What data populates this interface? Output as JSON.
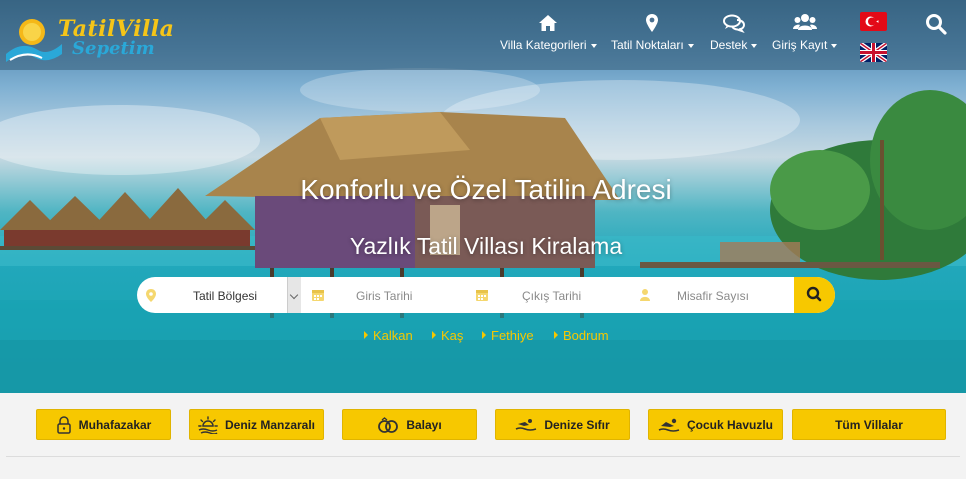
{
  "brand": {
    "line1": "TatilVilla",
    "line2": "Sepetim"
  },
  "nav": [
    {
      "label": "Villa Kategorileri",
      "icon": "home-icon"
    },
    {
      "label": "Tatil Noktaları",
      "icon": "map-marker-icon"
    },
    {
      "label": "Destek",
      "icon": "chat-icon"
    },
    {
      "label": "Giriş Kayıt",
      "icon": "users-icon"
    }
  ],
  "languages": [
    "turkish-flag-icon",
    "uk-flag-icon"
  ],
  "hero": {
    "title": "Konforlu ve Özel Tatilin Adresi",
    "subtitle": "Yazlık Tatil Villası Kiralama"
  },
  "search": {
    "region": "Tatil Bölgesi",
    "checkin": "Giris Tarihi",
    "checkout": "Çıkış Tarihi",
    "guests": "Misafir Sayısı"
  },
  "quick_links": [
    "Kalkan",
    "Kaş",
    "Fethiye",
    "Bodrum"
  ],
  "categories": [
    {
      "label": "Muhafazakar",
      "icon": "lock-icon"
    },
    {
      "label": "Deniz Manzaralı",
      "icon": "sun-icon"
    },
    {
      "label": "Balayı",
      "icon": "rings-icon"
    },
    {
      "label": "Denize Sıfır",
      "icon": "beach-icon"
    },
    {
      "label": "Çocuk Havuzlu",
      "icon": "swimmer-icon"
    },
    {
      "label": "Tüm Villalar",
      "icon": ""
    }
  ],
  "colors": {
    "accent": "#f7c800",
    "header": "#345c78",
    "sea": "#1da5b5"
  }
}
